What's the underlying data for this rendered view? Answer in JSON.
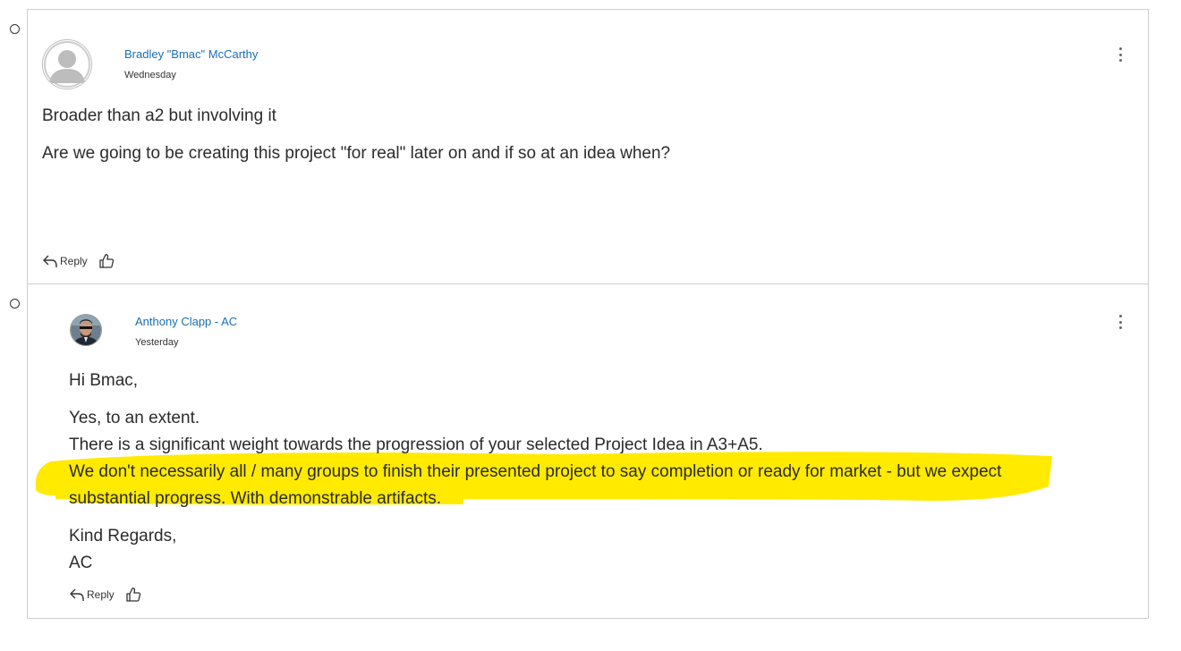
{
  "posts": [
    {
      "author": "Bradley \"Bmac\" McCarthy",
      "date": "Wednesday",
      "paragraphs": [
        "Broader than a2 but involving it",
        "Are we going to be creating this project \"for real\" later on and if so at an idea when?"
      ],
      "reply_label": "Reply",
      "avatar_icon": "default-user-avatar-icon"
    },
    {
      "author": "Anthony Clapp - AC",
      "date": "Yesterday",
      "greeting": "Hi Bmac,",
      "lines": [
        "Yes, to an extent.",
        "There is a significant weight towards the progression of your selected Project Idea in A3+A5.",
        "We don't necessarily all / many groups to finish their presented project to say completion or ready for market - but we expect",
        "substantial progress. With demonstrable artifacts."
      ],
      "signoff": [
        "Kind Regards,",
        "AC"
      ],
      "reply_label": "Reply",
      "avatar_icon": "user-photo-avatar-icon"
    }
  ],
  "colors": {
    "link": "#1a6fb5",
    "highlight": "#ffea00",
    "border": "#cfcfcf"
  }
}
